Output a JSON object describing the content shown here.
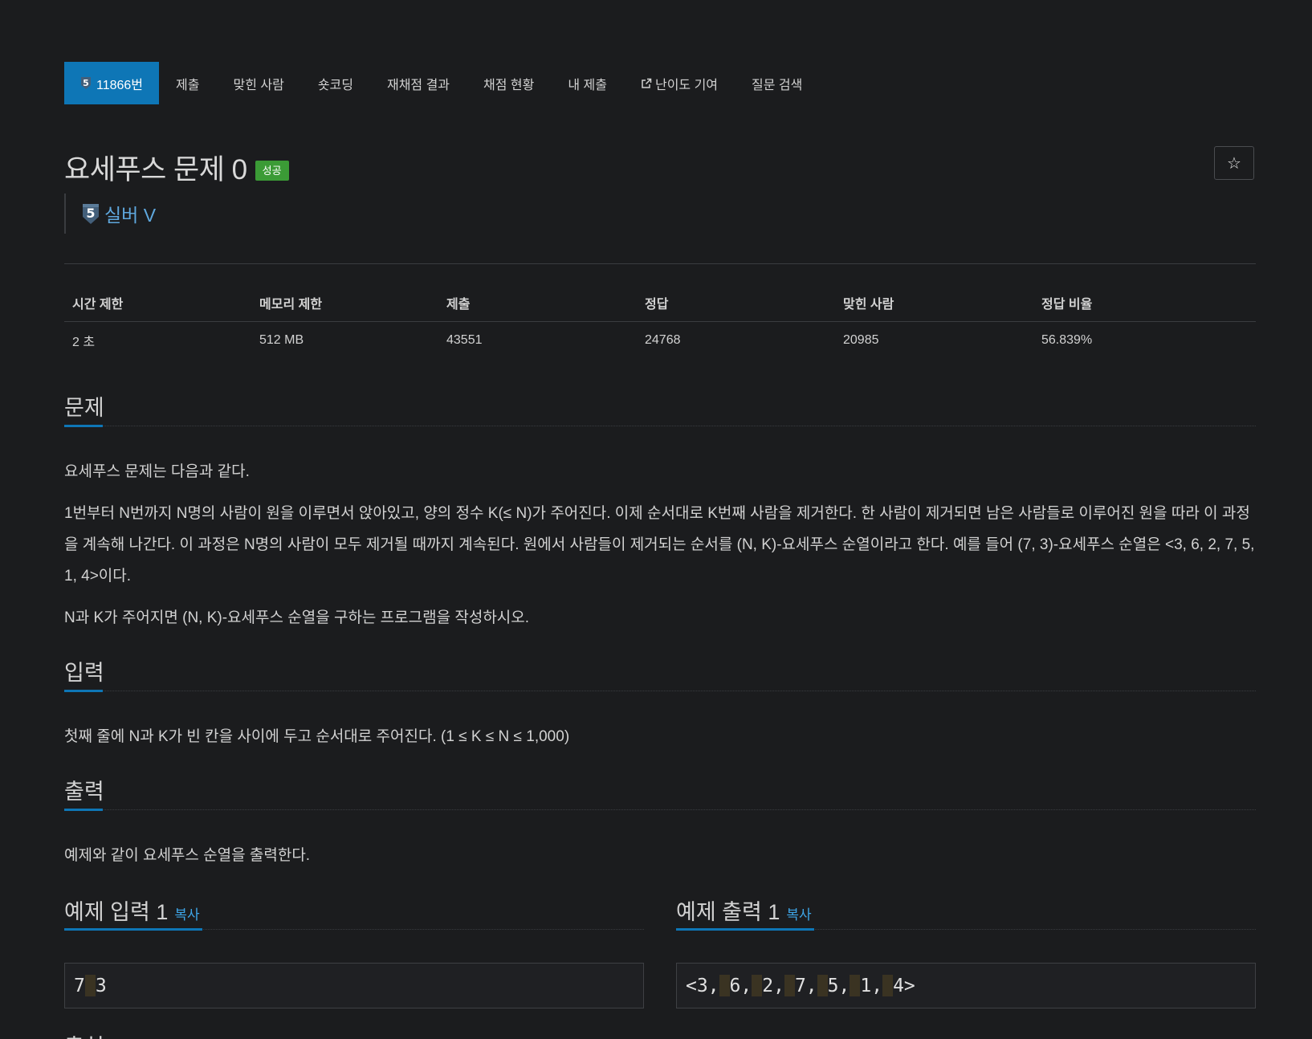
{
  "tabs": [
    {
      "label": "11866번",
      "active": true
    },
    {
      "label": "제출"
    },
    {
      "label": "맞힌 사람"
    },
    {
      "label": "숏코딩"
    },
    {
      "label": "재채점 결과"
    },
    {
      "label": "채점 현황"
    },
    {
      "label": "내 제출"
    },
    {
      "label": "난이도 기여",
      "icon": "external-link-icon"
    },
    {
      "label": "질문 검색"
    }
  ],
  "problem": {
    "title": "요세푸스 문제 0",
    "status_badge": "성공",
    "tier": "실버 V",
    "tier_level": "5",
    "star": "☆"
  },
  "info_table": {
    "headers": [
      "시간 제한",
      "메모리 제한",
      "제출",
      "정답",
      "맞힌 사람",
      "정답 비율"
    ],
    "values": [
      "2 초",
      "512 MB",
      "43551",
      "24768",
      "20985",
      "56.839%"
    ]
  },
  "sections": {
    "problem": {
      "heading": "문제",
      "paragraphs": [
        "요세푸스 문제는 다음과 같다.",
        "1번부터 N번까지 N명의 사람이 원을 이루면서 앉아있고, 양의 정수 K(≤ N)가 주어진다. 이제 순서대로 K번째 사람을 제거한다. 한 사람이 제거되면 남은 사람들로 이루어진 원을 따라 이 과정을 계속해 나간다. 이 과정은 N명의 사람이 모두 제거될 때까지 계속된다. 원에서 사람들이 제거되는 순서를 (N, K)-요세푸스 순열이라고 한다. 예를 들어 (7, 3)-요세푸스 순열은 <3, 6, 2, 7, 5, 1, 4>이다.",
        "N과 K가 주어지면 (N, K)-요세푸스 순열을 구하는 프로그램을 작성하시오."
      ]
    },
    "input": {
      "heading": "입력",
      "text": "첫째 줄에 N과 K가 빈 칸을 사이에 두고 순서대로 주어진다. (1 ≤ K ≤ N ≤ 1,000)"
    },
    "output": {
      "heading": "출력",
      "text": "예제와 같이 요세푸스 순열을 출력한다."
    }
  },
  "samples": {
    "input": {
      "heading": "예제 입력 1",
      "copy": "복사",
      "tokens": [
        "7",
        "3"
      ]
    },
    "output": {
      "heading": "예제 출력 1",
      "copy": "복사",
      "tokens": [
        "<3,",
        "6,",
        "2,",
        "7,",
        "5,",
        "1,",
        "4>"
      ]
    }
  },
  "next_section_heading": "출처",
  "colors": {
    "accent": "#0e76b6",
    "success": "#3b9b36",
    "tier_text": "#5fa8de",
    "link": "#3ea6e8",
    "background": "#1b1c1e"
  }
}
